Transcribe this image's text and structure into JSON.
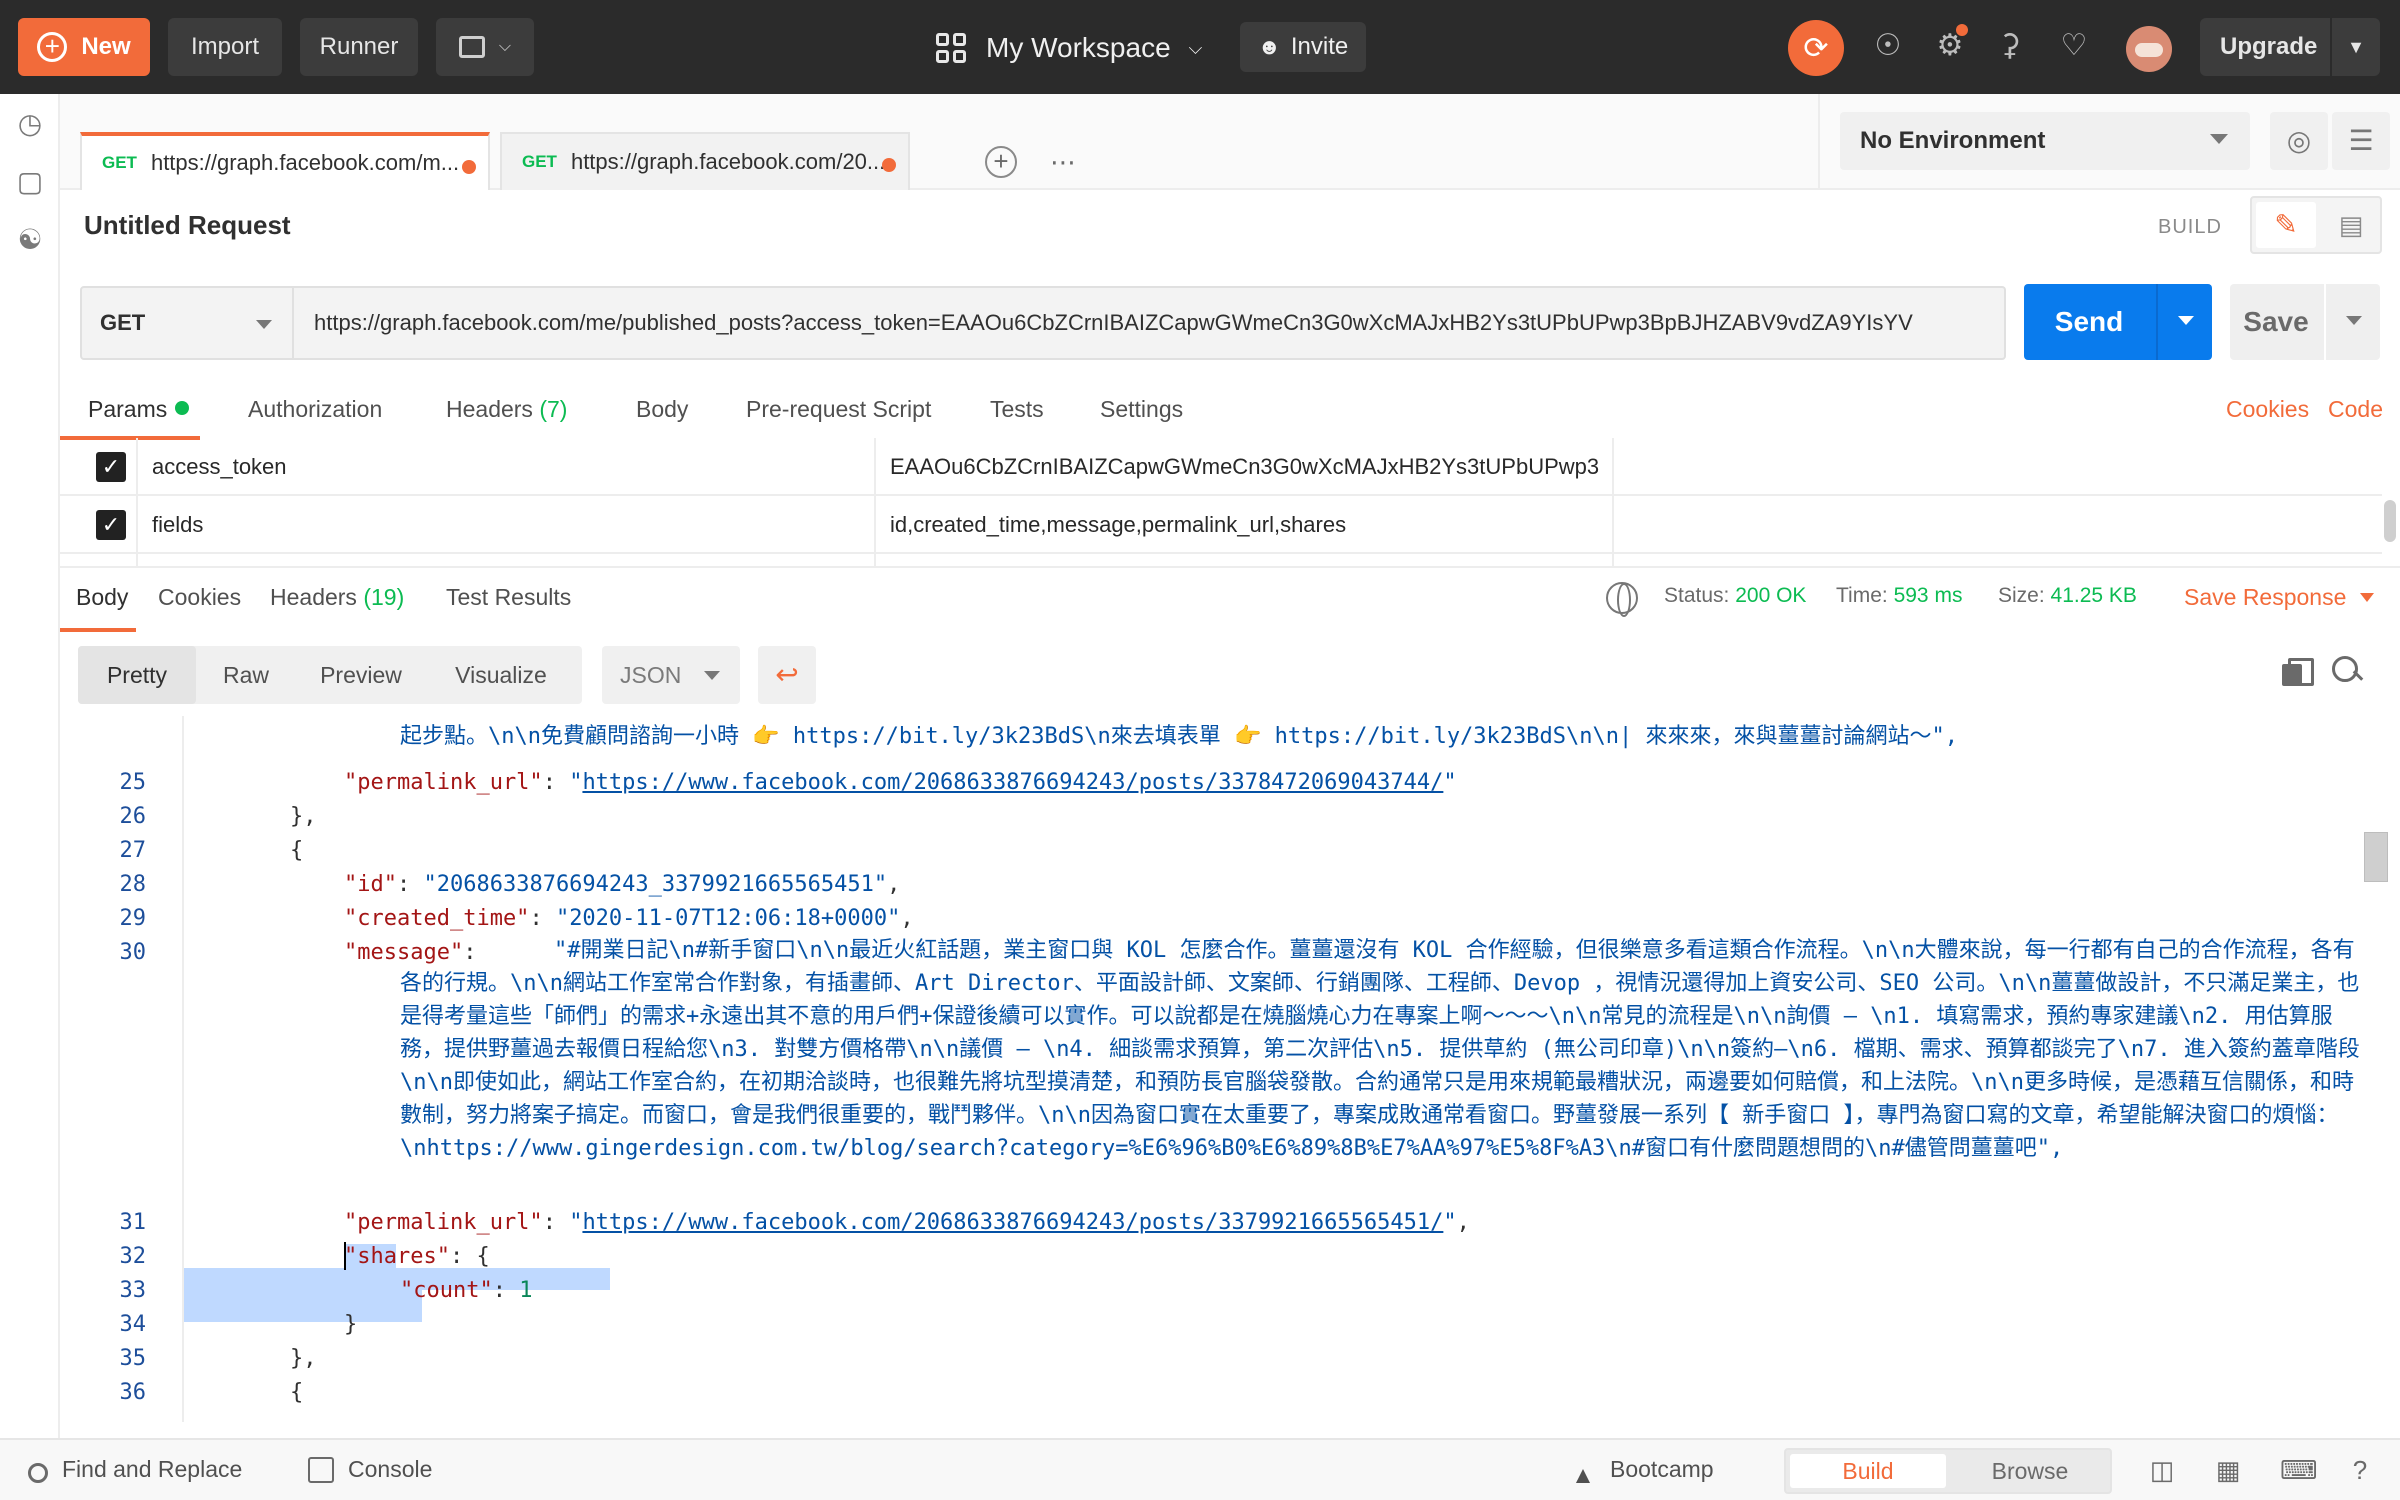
{
  "topbar": {
    "new_label": "New",
    "import_label": "Import",
    "runner_label": "Runner",
    "workspace_label": "My Workspace",
    "invite_label": "Invite",
    "upgrade_label": "Upgrade"
  },
  "tabs": [
    {
      "method": "GET",
      "label": "https://graph.facebook.com/m..."
    },
    {
      "method": "GET",
      "label": "https://graph.facebook.com/20..."
    }
  ],
  "environment": {
    "selected": "No Environment"
  },
  "request": {
    "title": "Untitled Request",
    "mode_label": "BUILD",
    "method": "GET",
    "url": "https://graph.facebook.com/me/published_posts?access_token=EAAOu6CbZCrnIBAIZCapwGWmeCn3G0wXcMAJxHB2Ys3tUPbUPwp3BpBJHZABV9vdZA9YIsYV",
    "send_label": "Send",
    "save_label": "Save"
  },
  "request_tabs": {
    "params": "Params",
    "authorization": "Authorization",
    "headers": "Headers",
    "headers_count": "(7)",
    "body": "Body",
    "prerequest": "Pre-request Script",
    "tests": "Tests",
    "settings": "Settings",
    "cookies": "Cookies",
    "code": "Code"
  },
  "params": [
    {
      "key": "access_token",
      "value": "EAAOu6CbZCrnIBAIZCapwGWmeCn3G0wXcMAJxHB2Ys3tUPbUPwp3"
    },
    {
      "key": "fields",
      "value": "id,created_time,message,permalink_url,shares"
    }
  ],
  "response": {
    "tabs": {
      "body": "Body",
      "cookies": "Cookies",
      "headers": "Headers",
      "headers_count": "(19)",
      "test_results": "Test Results"
    },
    "status_label": "Status:",
    "status": "200 OK",
    "time_label": "Time:",
    "time": "593 ms",
    "size_label": "Size:",
    "size": "41.25 KB",
    "save_response": "Save Response",
    "formats": [
      "Pretty",
      "Raw",
      "Preview",
      "Visualize"
    ],
    "language": "JSON"
  },
  "code": {
    "top_wrap": "起步點。\\n\\n免費顧問諮詢一小時 👉 https://bit.ly/3k23BdS\\n來去填表單 👉 https://bit.ly/3k23BdS\\n\\n| 來來來，來與薑薑討論網站～\",",
    "permalink_1": "https://www.facebook.com/2068633876694243/posts/3378472069043744/",
    "id_value": "2068633876694243_3379921665565451",
    "created_time": "2020-11-07T12:06:18+0000",
    "message": "#開業日記\\n#新手窗口\\n\\n最近火紅話題，業主窗口與 KOL 怎麼合作。薑薑還沒有 KOL 合作經驗，但很樂意多看這類合作流程。\\n\\n大體來說，每一行都有自己的合作流程，各有各的行規。\\n\\n網站工作室常合作對象，有插畫師、Art Director、平面設計師、文案師、行銷團隊、工程師、Devop ，視情況還得加上資安公司、SEO 公司。\\n\\n薑薑做設計，不只滿足業主，也是得考量這些「師們」的需求+永遠出其不意的用戶們+保證後續可以實作。可以說都是在燒腦燒心力在專案上啊～～～\\n\\n常見的流程是\\n\\n詢價 – \\n1. 填寫需求，預約專家建議\\n2. 用估算服務，提供野薑過去報價日程給您\\n3. 對雙方價格帶\\n\\n議價 – \\n4. 細談需求預算，第二次評估\\n5. 提供草約 (無公司印章)\\n\\n簽約–\\n6. 檔期、需求、預算都談完了\\n7. 進入簽約蓋章階段\\n\\n即使如此，網站工作室合約，在初期洽談時，也很難先將坑型摸清楚，和預防長官腦袋發散。合約通常只是用來規範最糟狀況，兩邊要如何賠償，和上法院。\\n\\n更多時候，是憑藉互信關係，和時數制，努力將案子搞定。而窗口，會是我們很重要的，戰鬥夥伴。\\n\\n因為窗口實在太重要了，專案成敗通常看窗口。野薑發展一系列【 新手窗口 】，專門為窗口寫的文章，希望能解決窗口的煩惱：\\nhttps://www.gingerdesign.com.tw/blog/search?category=%E6%96%B0%E6%89%8B%E7%AA%97%E5%8F%A3\\n#窗口有什麼問題想問的\\n#儘管問薑薑吧",
    "permalink_2": "https://www.facebook.com/2068633876694243/posts/3379921665565451/",
    "count": "1",
    "line_numbers": [
      "25",
      "26",
      "27",
      "28",
      "29",
      "30",
      "31",
      "32",
      "33",
      "34",
      "35",
      "36"
    ]
  },
  "bottombar": {
    "find_replace": "Find and Replace",
    "console": "Console",
    "bootcamp": "Bootcamp",
    "build": "Build",
    "browse": "Browse"
  }
}
